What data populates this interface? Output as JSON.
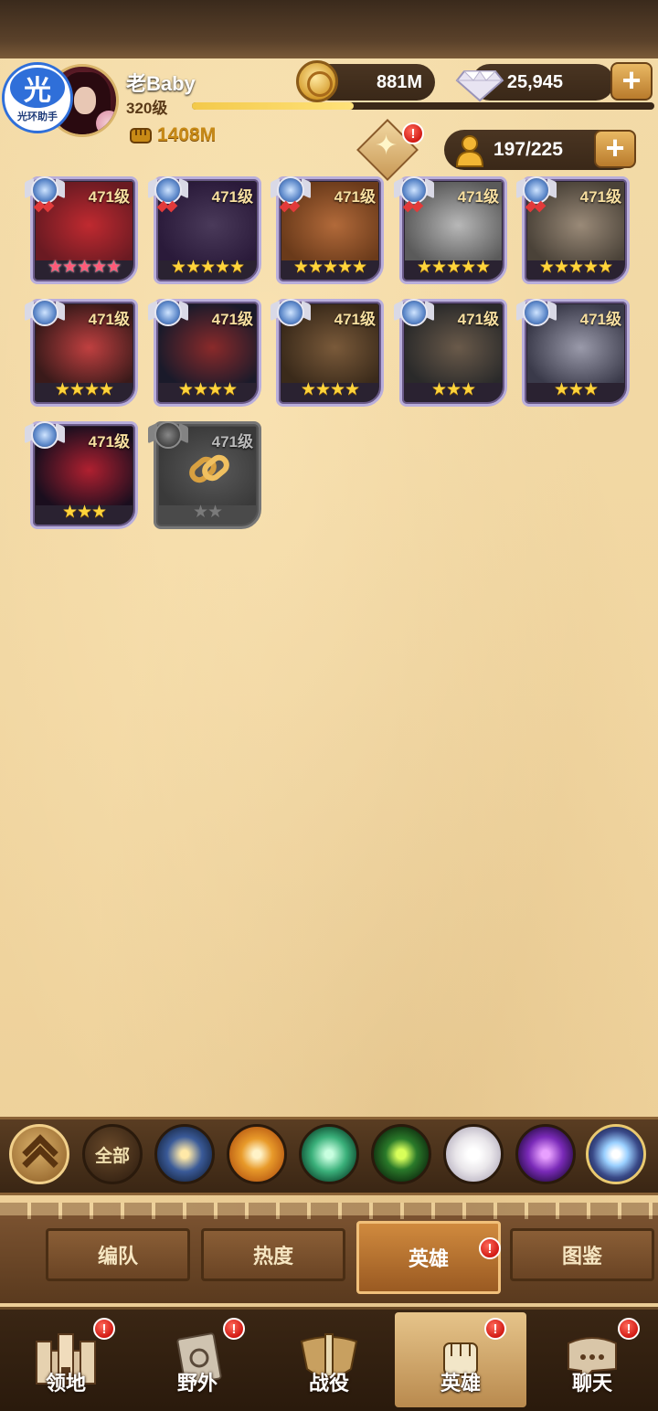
{
  "assistant_badge": {
    "glyph": "光",
    "label": "光环助手"
  },
  "player": {
    "name": "老Baby",
    "level": "320级",
    "xp_progress": 0.35,
    "power": "1408M"
  },
  "resources": {
    "gold": "881M",
    "diamonds": "25,945",
    "roster": "197/225"
  },
  "heroes": [
    {
      "level": "471级",
      "stars": "★★★★★",
      "star_color": "red",
      "tier": "ascended-red"
    },
    {
      "level": "471级",
      "stars": "★★★★★",
      "star_color": "gold",
      "tier": "ascended-red"
    },
    {
      "level": "471级",
      "stars": "★★★★★",
      "star_color": "gold",
      "tier": "ascended-red"
    },
    {
      "level": "471级",
      "stars": "★★★★★",
      "star_color": "gold",
      "tier": "ascended-red"
    },
    {
      "level": "471级",
      "stars": "★★★★★",
      "star_color": "gold",
      "tier": "ascended-red"
    },
    {
      "level": "471级",
      "stars": "★★★★",
      "star_color": "gold",
      "tier": "ascended"
    },
    {
      "level": "471级",
      "stars": "★★★★",
      "star_color": "gold",
      "tier": "ascended"
    },
    {
      "level": "471级",
      "stars": "★★★★",
      "star_color": "gold",
      "tier": "ascended"
    },
    {
      "level": "471级",
      "stars": "★★★",
      "star_color": "gold",
      "tier": "ascended"
    },
    {
      "level": "471级",
      "stars": "★★★",
      "star_color": "gold",
      "tier": "ascended"
    },
    {
      "level": "471级",
      "stars": "★★★",
      "star_color": "gold",
      "tier": "ascended"
    },
    {
      "level": "471级",
      "stars": "★★",
      "star_color": "gray",
      "tier": "locked"
    }
  ],
  "filters": {
    "collapse_icon": "chevron-up-icon",
    "all_label": "全部",
    "factions": [
      "lightbearer-icon",
      "mauler-icon",
      "wilder-icon",
      "graveborn-icon",
      "celestial-icon",
      "hypogean-icon",
      "dimensional-icon"
    ]
  },
  "subtabs": [
    "编队",
    "热度",
    "英雄",
    "图鉴"
  ],
  "nav": [
    "领地",
    "野外",
    "战役",
    "英雄",
    "聊天"
  ],
  "colors": {
    "accent_gold": "#ffd43b",
    "alert_red": "#d21a14",
    "parchment": "#f0d49e"
  }
}
